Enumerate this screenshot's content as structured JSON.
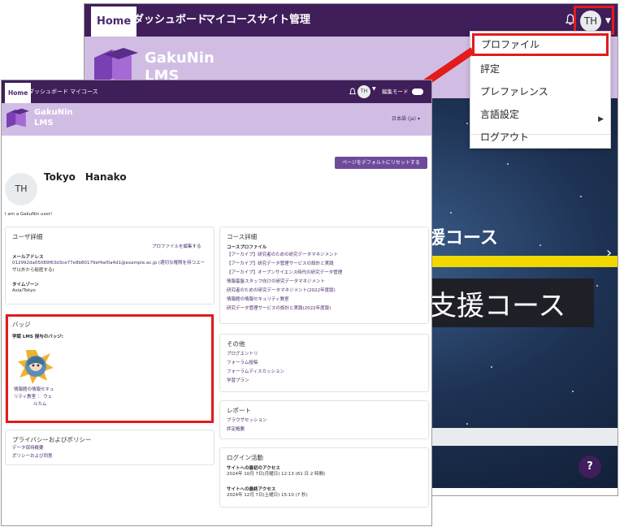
{
  "back_window": {
    "nav": {
      "home": "Home",
      "dashboard": "ダッシュボード",
      "my_courses": "マイコース",
      "site_admin": "サイト管理"
    },
    "avatar_initials": "TH",
    "logo_line1": "GakuNin",
    "logo_line2": "LMS",
    "course_banner_line1": "援コース",
    "course_banner_line2": "支援コース",
    "help": "?"
  },
  "user_menu": {
    "items": [
      {
        "label": "プロファイル",
        "highlighted": true
      },
      {
        "label": "評定"
      },
      {
        "label": "プレファレンス"
      },
      {
        "label": "言語設定",
        "has_submenu": true
      },
      {
        "label": "ログアウト"
      }
    ]
  },
  "front_window": {
    "nav": {
      "home": "Home",
      "dashboard": "ダッシュボード",
      "my_courses": "マイコース"
    },
    "avatar_initials": "TH",
    "edit_mode": "編集モード",
    "logo_line1": "GakuNin",
    "logo_line2": "LMS",
    "language": "日本語 (ja) ▾",
    "reset_button": "ページをデフォルトにリセットする",
    "profile": {
      "initials": "TH",
      "name": "Tokyo　Hanako",
      "bio": "I am a GakuNin user!"
    },
    "user_details": {
      "title": "ユーザ詳細",
      "edit_link": "プロファイルを編集する",
      "email_label": "メールアドレス",
      "email_value": "012992da05089f63d3ce77e8b80179ef4af0a4d1@example.ac.jp (適切な権限を持つユー",
      "email_value2": "ザ以外から秘匿する)",
      "timezone_label": "タイムゾーン",
      "timezone_value": "Asia/Tokyo"
    },
    "badges": {
      "title": "バッジ",
      "subtitle": "学認 LMS 授与のバッジ:",
      "badge_name_line1": "情報館の情報セキュ",
      "badge_name_line2": "リティ教室 ： ウェ",
      "badge_name_line3": "ルカム"
    },
    "privacy": {
      "title": "プライバシーおよびポリシー",
      "links": [
        "データ保持概要",
        "ポリシーおよび同意"
      ]
    },
    "course_details": {
      "title": "コース詳細",
      "subtitle": "コースプロファイル",
      "courses": [
        "【アーカイブ】研究者のための研究データマネジメント",
        "【アーカイブ】研究データ管理サービスの設計と実践",
        "【アーカイブ】オープンサイエンス時代の研究データ管理",
        "情報基盤スタッフ向けの研究データマネジメント",
        "研究者のための研究データマネジメント(2022年度版)",
        "情報館の情報セキュリティ教室",
        "研究データ管理サービスの設計と実践(2022年度版)"
      ]
    },
    "misc": {
      "title": "その他",
      "links": [
        "ブログエントリ",
        "フォーラム投稿",
        "フォーラムディスカッション",
        "学習プラン"
      ]
    },
    "reports": {
      "title": "レポート",
      "links": [
        "ブラウザセッション",
        "評定概要"
      ]
    },
    "login_activity": {
      "title": "ログイン活動",
      "first_label": "サイトへの最初のアクセス",
      "first_value": "2024年 10月 7日(月曜日) 12:13  (61 日 2 時間)",
      "last_label": "サイトへの最終アクセス",
      "last_value": "2024年 12月 7日(土曜日) 15:10  (7 秒)"
    }
  },
  "colors": {
    "navbar": "#3f1e5a",
    "banner": "#d1bde4",
    "accent": "#6f4a9b",
    "highlight_red": "#e31b1b"
  }
}
